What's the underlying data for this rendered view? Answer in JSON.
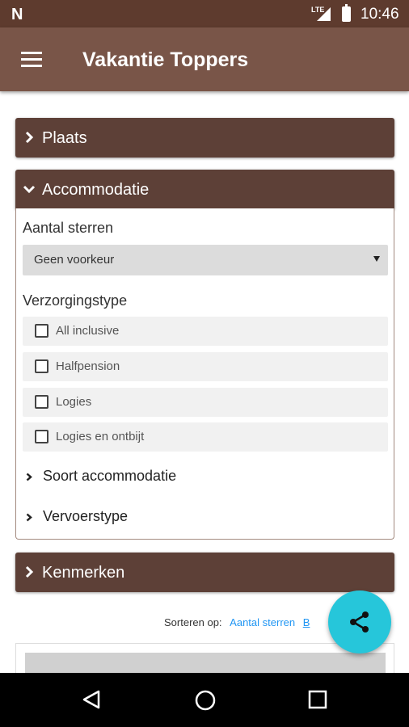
{
  "status_bar": {
    "network": "LTE",
    "time": "10:46"
  },
  "app_bar": {
    "title": "Vakantie Toppers"
  },
  "panels": {
    "plaats": {
      "label": "Plaats"
    },
    "accommodatie": {
      "label": "Accommodatie",
      "stars_label": "Aantal sterren",
      "stars_value": "Geen voorkeur",
      "board_label": "Verzorgingstype",
      "board_options": [
        "All inclusive",
        "Halfpension",
        "Logies",
        "Logies en ontbijt"
      ],
      "sub_sections": [
        "Soort accommodatie",
        "Vervoerstype"
      ]
    },
    "kenmerken": {
      "label": "Kenmerken"
    }
  },
  "sort": {
    "label": "Sorteren op:",
    "option_1": "Aantal sterren",
    "option_2": "B"
  },
  "icons": {
    "menu": "menu-icon",
    "share": "share-icon",
    "chevron": "chevron-right-icon"
  },
  "colors": {
    "status_bar": "#5e3b2e",
    "app_bar": "#795548",
    "panel": "#5d4037",
    "fab": "#26c6da",
    "link": "#2196f3"
  }
}
